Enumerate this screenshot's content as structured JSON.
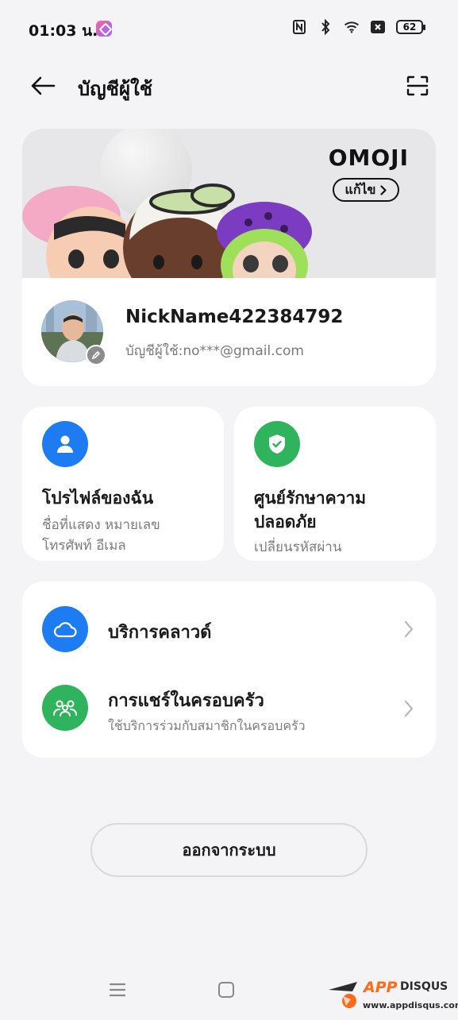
{
  "status_bar": {
    "time": "01:03 น.",
    "battery": "62",
    "icons": [
      "app-notification-icon",
      "nfc-icon",
      "bluetooth-icon",
      "wifi-icon",
      "sim-off-icon",
      "battery-icon"
    ]
  },
  "header": {
    "title": "บัญชีผู้ใช้",
    "back_icon": "arrow-left-icon",
    "scan_icon": "scan-icon"
  },
  "profile": {
    "omoji_logo": "OMOJI",
    "omoji_edit_label": "แก้ไข",
    "nickname": "NickName422384792",
    "account_line": "บัญชีผู้ใช้:no***@gmail.com"
  },
  "tiles": {
    "my_profile": {
      "title": "โปรไฟล์ของฉัน",
      "subtitle_line1": "ชื่อที่แสดง หมายเลข",
      "subtitle_line2": "โทรศัพท์ อีเมล",
      "icon": "person-icon",
      "icon_color": "#1e7cf2"
    },
    "security": {
      "title_line1": "ศูนย์รักษาความ",
      "title_line2": "ปลอดภัย",
      "subtitle": "เปลี่ยนรหัสผ่าน",
      "icon": "shield-check-icon",
      "icon_color": "#2fb35c"
    }
  },
  "services": [
    {
      "title": "บริการคลาวด์",
      "subtitle": "",
      "icon": "cloud-icon",
      "icon_color": "#1e7cf2"
    },
    {
      "title": "การแชร์ในครอบครัว",
      "subtitle": "ใช้บริการร่วมกับสมาชิกในครอบครัว",
      "icon": "family-icon",
      "icon_color": "#2fb35c"
    }
  ],
  "logout_label": "ออกจากระบบ",
  "watermark": {
    "app": "APP",
    "disqus": "DISQUS",
    "url": "www.appdisqus.com"
  }
}
